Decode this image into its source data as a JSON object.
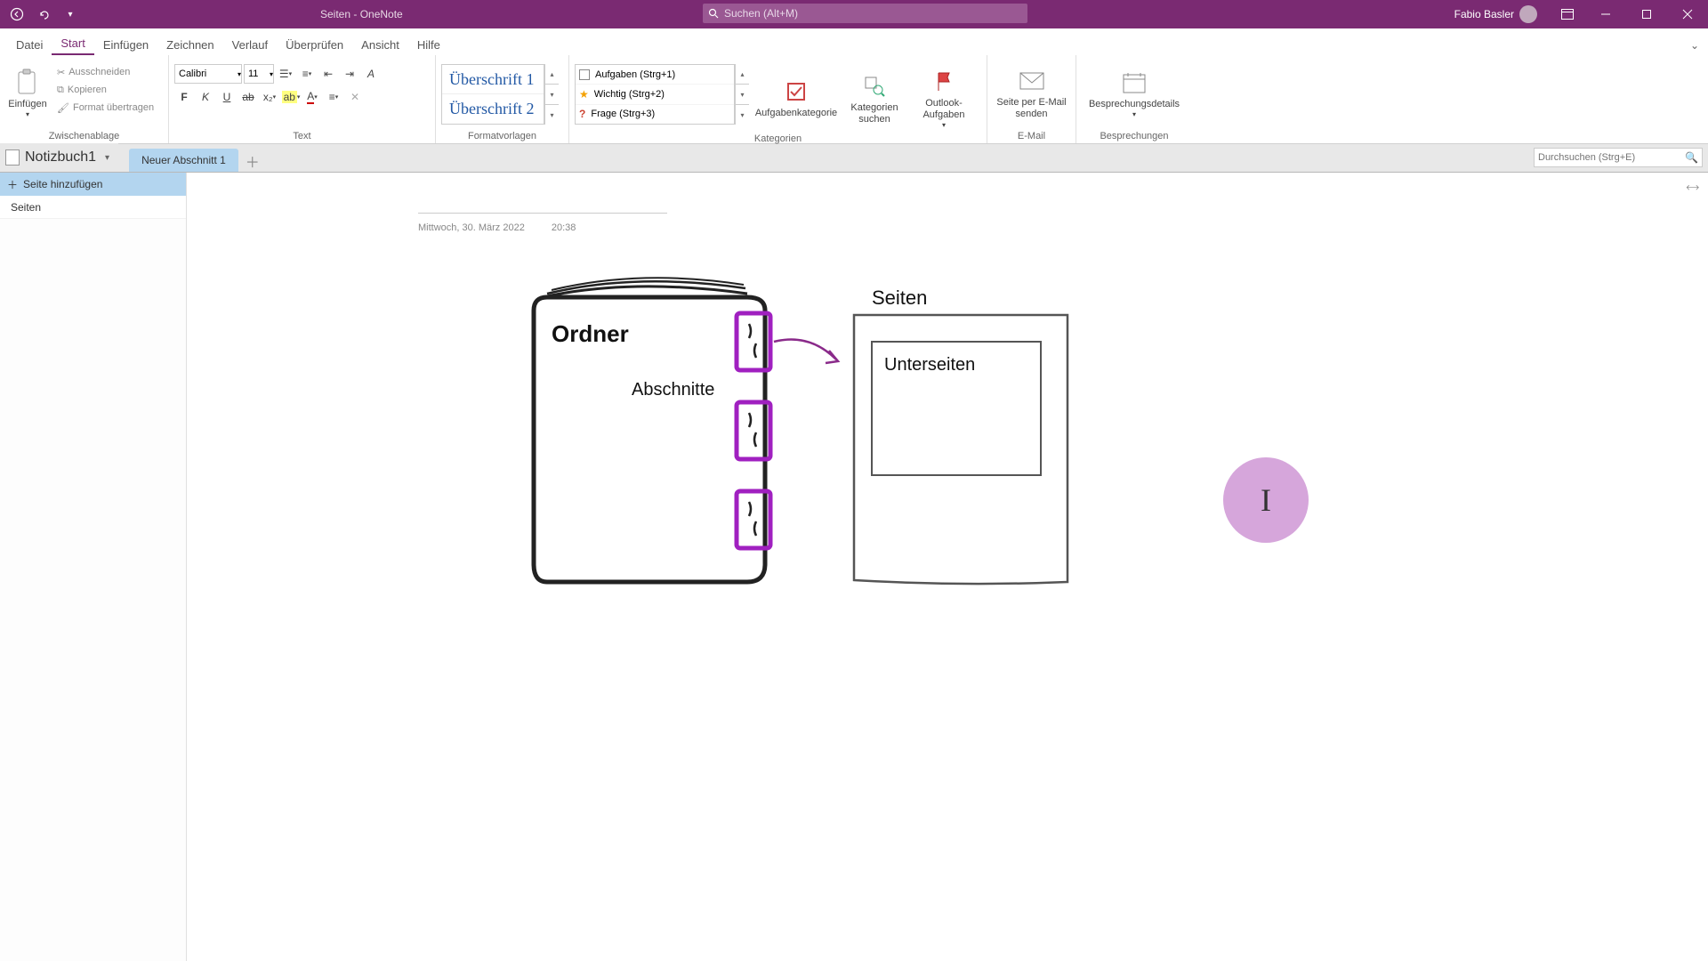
{
  "app": {
    "title": "Seiten  -  OneNote",
    "user_name": "Fabio Basler",
    "search_placeholder": "Suchen (Alt+M)"
  },
  "menu": {
    "tabs": [
      "Datei",
      "Start",
      "Einfügen",
      "Zeichnen",
      "Verlauf",
      "Überprüfen",
      "Ansicht",
      "Hilfe"
    ],
    "active_index": 1
  },
  "ribbon": {
    "clipboard": {
      "paste": "Einfügen",
      "cut": "Ausschneiden",
      "copy": "Kopieren",
      "format_painter": "Format übertragen",
      "group_label": "Zwischenablage"
    },
    "text": {
      "font": "Calibri",
      "size": "11",
      "group_label": "Text"
    },
    "styles": {
      "items": [
        "Überschrift 1",
        "Überschrift 2"
      ],
      "group_label": "Formatvorlagen"
    },
    "tags": {
      "items": [
        {
          "label": "Aufgaben (Strg+1)"
        },
        {
          "label": "Wichtig (Strg+2)"
        },
        {
          "label": "Frage (Strg+3)"
        }
      ],
      "task_cat": "Aufgabenkategorie",
      "find_tags": "Kategorien suchen",
      "outlook": "Outlook-Aufgaben",
      "group_label": "Kategorien"
    },
    "email": {
      "send": "Seite per E-Mail senden",
      "group_label": "E-Mail"
    },
    "meeting": {
      "details": "Besprechungsdetails",
      "group_label": "Besprechungen"
    }
  },
  "notebook": {
    "name": "Notizbuch1",
    "section": "Neuer Abschnitt 1",
    "search_placeholder": "Durchsuchen (Strg+E)"
  },
  "pages": {
    "add_label": "Seite hinzufügen",
    "items": [
      "Seiten"
    ]
  },
  "page": {
    "date": "Mittwoch, 30. März 2022",
    "time": "20:38"
  },
  "drawing": {
    "ordner": "Ordner",
    "abschnitte": "Abschnitte",
    "seiten": "Seiten",
    "unterseiten": "Unterseiten"
  }
}
